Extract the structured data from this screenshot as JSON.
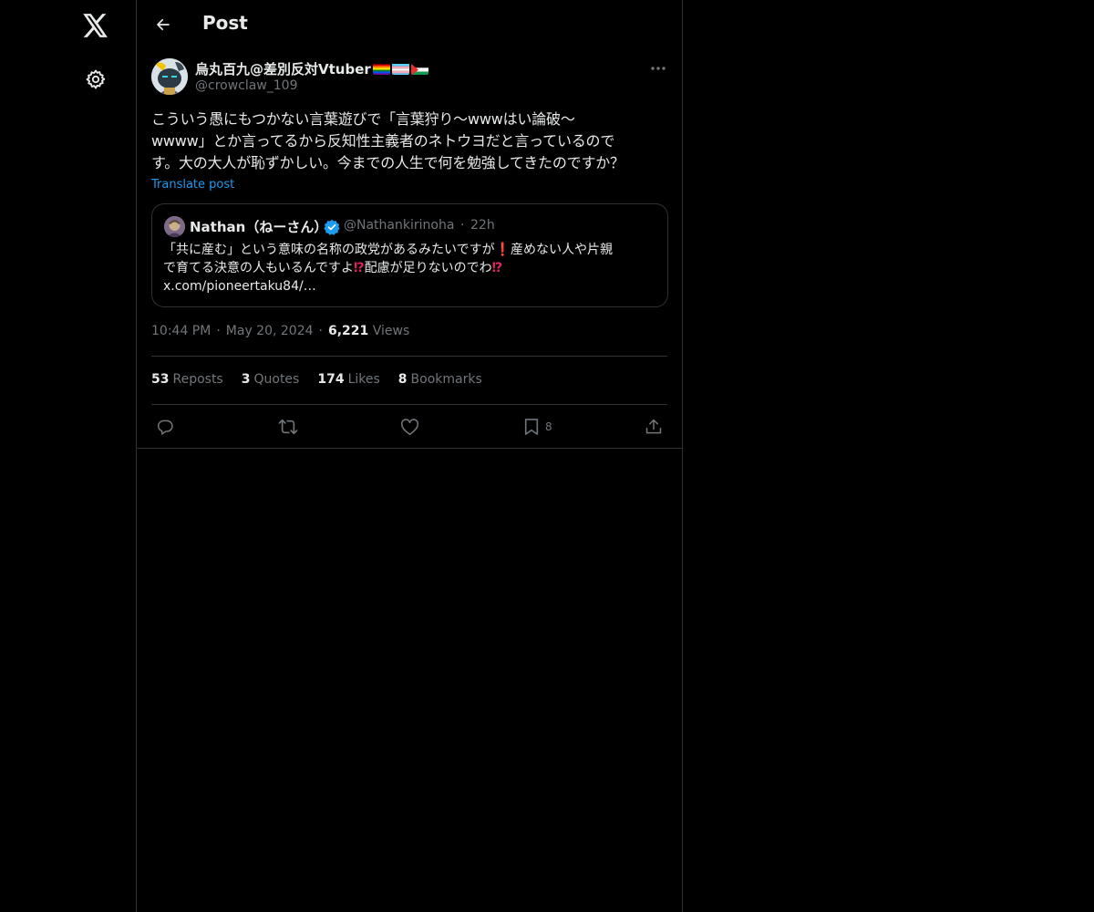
{
  "header": {
    "title": "Post"
  },
  "post": {
    "author_name": "烏丸百九@差別反対Vtuber",
    "author_handle": "@crowclaw_109",
    "text_lines": [
      "こういう愚にもつかない言葉遊びで「言葉狩り〜wwwはい論破〜",
      "wwww」とか言ってるから反知性主義者のネトウヨだと言っているので",
      "す。大の大人が恥ずかしい。今までの人生で何を勉強してきたのですか？"
    ],
    "translate_label": "Translate post",
    "time": "10:44 PM",
    "date": "May 20, 2024",
    "views_count": "6,221",
    "views_label": "Views",
    "sep": "·"
  },
  "quote": {
    "name": "Nathan（ねーさん）",
    "handle": "@Nathankirinoha",
    "sep": "·",
    "time": "22h",
    "line1_a": "「共に産む」という意味の名称の政党があるみたいですが",
    "line1_emoji": "❗",
    "line1_b": "産めない人や片親",
    "line2_a": "で育てる決意の人もいるんですよ",
    "line2_emoji": "⁉",
    "line2_b": "配慮が足りないのでわ",
    "line2_emoji2": "⁉",
    "line3": "x.com/pioneertaku84/…"
  },
  "stats": {
    "reposts_count": "53",
    "reposts_label": "Reposts",
    "quotes_count": "3",
    "quotes_label": "Quotes",
    "likes_count": "174",
    "likes_label": "Likes",
    "bookmarks_count": "8",
    "bookmarks_label": "Bookmarks"
  },
  "actions": {
    "bookmark_count": "8"
  },
  "icons": {
    "logo": "x-logo-icon",
    "settings": "gear-icon",
    "back": "arrow-left-icon",
    "more": "more-horizontal-icon",
    "verified": "verified-badge-icon",
    "reply": "reply-icon",
    "repost": "repost-icon",
    "like": "heart-icon",
    "bookmark": "bookmark-icon",
    "share": "share-icon"
  },
  "colors": {
    "background": "#000000",
    "text": "#e7e9ea",
    "secondary": "#71767b",
    "link": "#1d9bf0",
    "border": "#2f3336"
  }
}
